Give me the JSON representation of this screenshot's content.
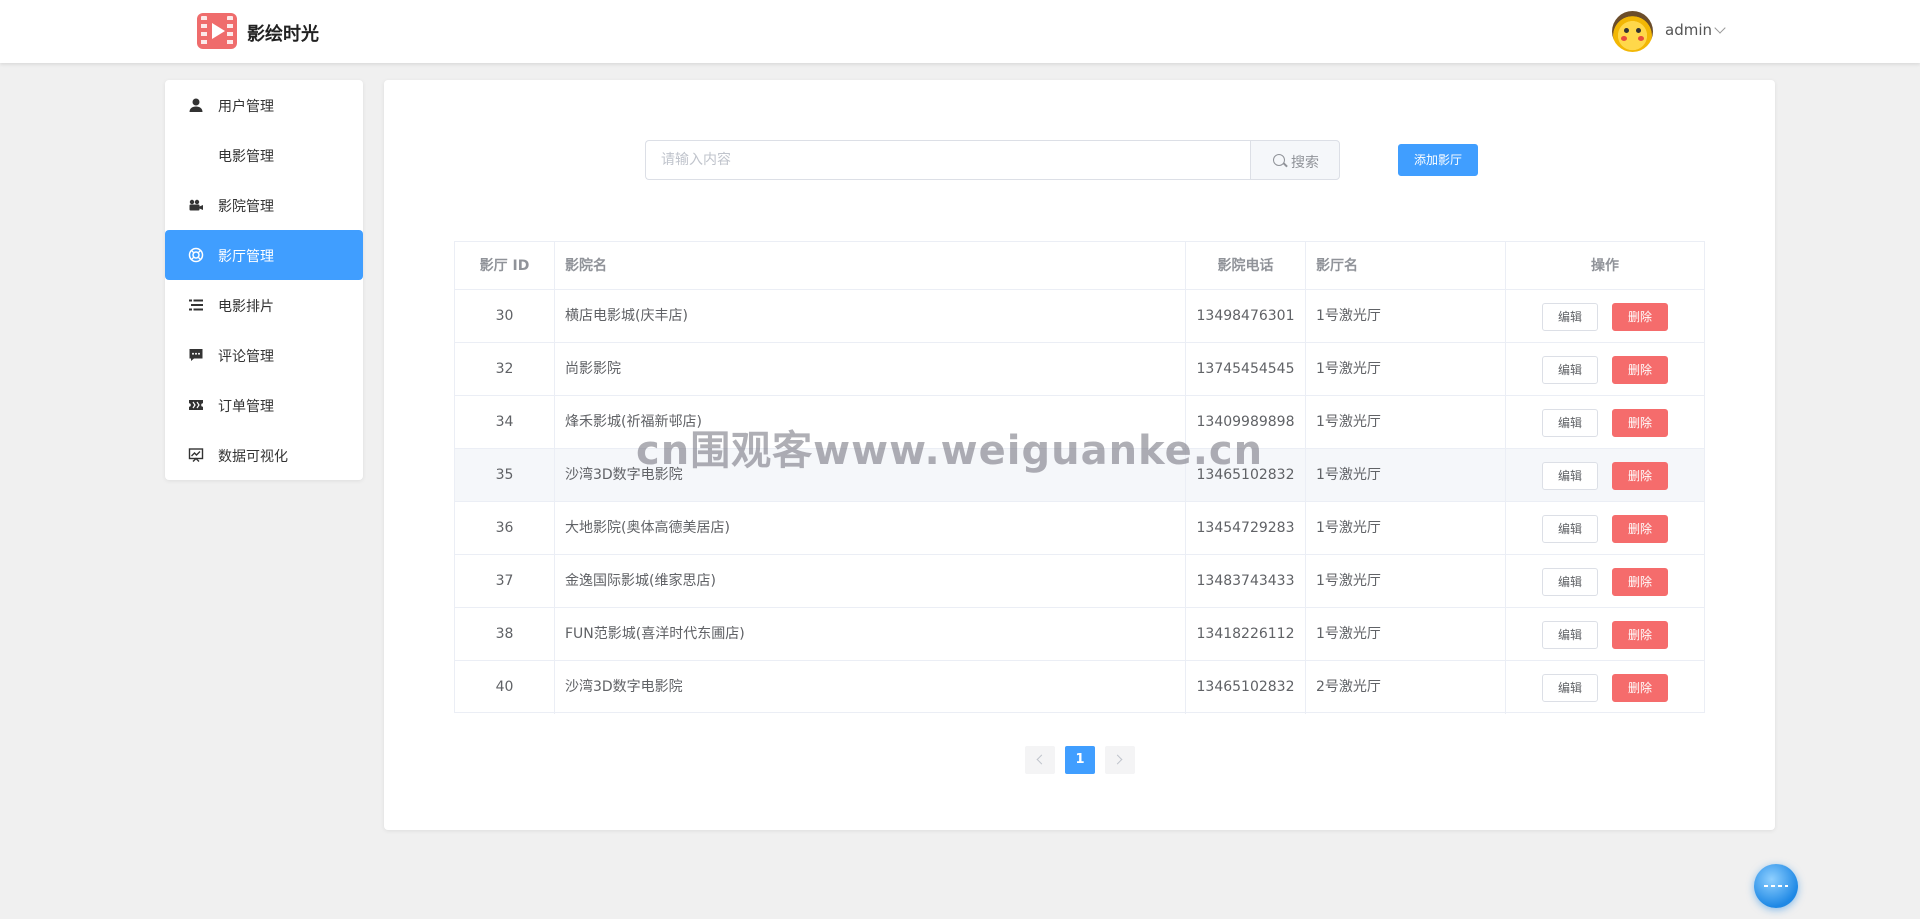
{
  "header": {
    "brand": "影绘时光",
    "username": "admin"
  },
  "sidebar": {
    "items": [
      {
        "label": "用户管理",
        "icon": "user-icon"
      },
      {
        "label": "电影管理",
        "icon": ""
      },
      {
        "label": "影院管理",
        "icon": "camera-icon"
      },
      {
        "label": "影厅管理",
        "icon": "ring-icon",
        "active": true
      },
      {
        "label": "电影排片",
        "icon": "list-icon"
      },
      {
        "label": "评论管理",
        "icon": "comment-icon"
      },
      {
        "label": "订单管理",
        "icon": "ticket-icon"
      },
      {
        "label": "数据可视化",
        "icon": "chart-icon"
      }
    ]
  },
  "search": {
    "placeholder": "请输入内容",
    "button_label": "搜索"
  },
  "add_button": "添加影厅",
  "table": {
    "headers": {
      "id": "影厅 ID",
      "cinema": "影院名",
      "phone": "影院电话",
      "hall": "影厅名",
      "ops": "操作"
    },
    "rows": [
      {
        "id": "30",
        "cinema": "横店电影城(庆丰店)",
        "phone": "13498476301",
        "hall": "1号激光厅"
      },
      {
        "id": "32",
        "cinema": "尚影影院",
        "phone": "13745454545",
        "hall": "1号激光厅"
      },
      {
        "id": "34",
        "cinema": "烽禾影城(祈福新邨店)",
        "phone": "13409989898",
        "hall": "1号激光厅"
      },
      {
        "id": "35",
        "cinema": "沙湾3D数字电影院",
        "phone": "13465102832",
        "hall": "1号激光厅"
      },
      {
        "id": "36",
        "cinema": "大地影院(奥体高德美居店)",
        "phone": "13454729283",
        "hall": "1号激光厅"
      },
      {
        "id": "37",
        "cinema": "金逸国际影城(维家思店)",
        "phone": "13483743433",
        "hall": "1号激光厅"
      },
      {
        "id": "38",
        "cinema": "FUN范影城(喜洋时代东圃店)",
        "phone": "13418226112",
        "hall": "1号激光厅"
      },
      {
        "id": "40",
        "cinema": "沙湾3D数字电影院",
        "phone": "13465102832",
        "hall": "2号激光厅"
      }
    ],
    "edit_label": "编辑",
    "delete_label": "删除"
  },
  "pagination": {
    "current": "1"
  },
  "watermark": "cn围观客www.weiguanke.cn",
  "colors": {
    "primary": "#409eff",
    "danger": "#f56c6c",
    "background": "#f0f0f0"
  }
}
